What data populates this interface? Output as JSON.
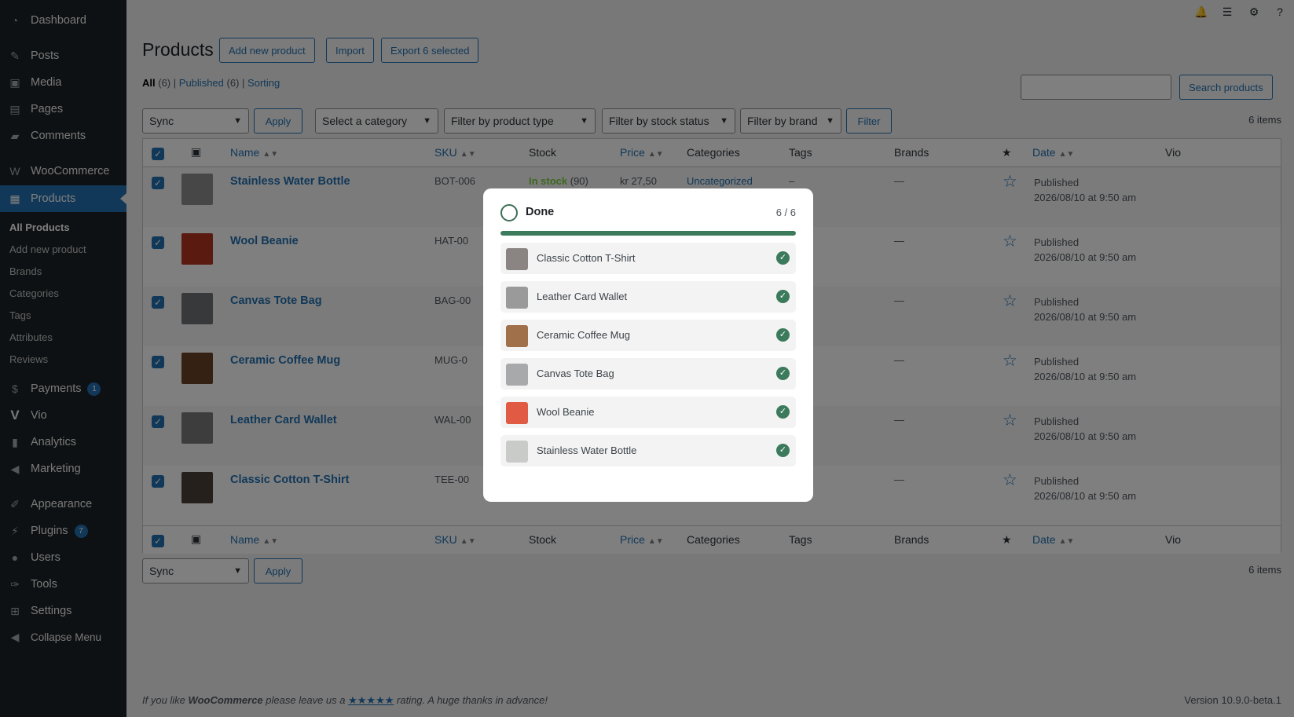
{
  "sidebar": {
    "top": [
      {
        "label": "Dashboard",
        "icon": "dashboard-icon"
      },
      {
        "label": "Posts",
        "icon": "pin-icon"
      },
      {
        "label": "Media",
        "icon": "media-icon"
      },
      {
        "label": "Pages",
        "icon": "page-icon"
      },
      {
        "label": "Comments",
        "icon": "comment-icon"
      },
      {
        "label": "WooCommerce",
        "icon": "woocommerce-icon"
      },
      {
        "label": "Products",
        "icon": "products-icon"
      }
    ],
    "submenu": [
      "All Products",
      "Add new product",
      "Brands",
      "Categories",
      "Tags",
      "Attributes",
      "Reviews"
    ],
    "bottom": [
      {
        "label": "Payments",
        "icon": "payments-icon",
        "badge": "1"
      },
      {
        "label": "Vio",
        "icon": "vio-icon"
      },
      {
        "label": "Analytics",
        "icon": "analytics-icon"
      },
      {
        "label": "Marketing",
        "icon": "megaphone-icon"
      },
      {
        "label": "Appearance",
        "icon": "brush-icon"
      },
      {
        "label": "Plugins",
        "icon": "plugin-icon",
        "badge": "7"
      },
      {
        "label": "Users",
        "icon": "users-icon"
      },
      {
        "label": "Tools",
        "icon": "wrench-icon"
      },
      {
        "label": "Settings",
        "icon": "settings-icon"
      },
      {
        "label": "Collapse Menu",
        "icon": "collapse-icon"
      }
    ]
  },
  "header": {
    "title": "Products",
    "add_new": "Add new product",
    "import": "Import",
    "export": "Export 6 selected"
  },
  "views": {
    "all": "All",
    "all_count": "(6)",
    "published": "Published",
    "published_count": "(6)",
    "sorting": "Sorting",
    "sep": "|"
  },
  "search": {
    "button": "Search products",
    "value": ""
  },
  "filters": {
    "bulk_action": "Sync",
    "apply": "Apply",
    "category": "Select a category",
    "product_type": "Filter by product type",
    "stock_status": "Filter by stock status",
    "brand": "Filter by brand",
    "filter": "Filter",
    "items_count": "6 items"
  },
  "columns": {
    "name": "Name",
    "sku": "SKU",
    "stock": "Stock",
    "price": "Price",
    "categories": "Categories",
    "tags": "Tags",
    "brands": "Brands",
    "date": "Date",
    "vio": "Vio"
  },
  "products": [
    {
      "name": "Stainless Water Bottle",
      "sku": "BOT-006",
      "stock_status": "In stock",
      "stock_qty": "(90)",
      "price": "kr 27,50",
      "category": "Uncategorized",
      "tags": "–",
      "brands": "—",
      "status": "Published",
      "date": "2026/08/10 at 9:50 am",
      "thumb_color": "#8d8f8c"
    },
    {
      "name": "Wool Beanie",
      "sku": "HAT-00",
      "stock_status": "",
      "stock_qty": "",
      "price": "",
      "category": "",
      "tags": "–",
      "brands": "—",
      "status": "Published",
      "date": "2026/08/10 at 9:50 am",
      "thumb_color": "#b5351f"
    },
    {
      "name": "Canvas Tote Bag",
      "sku": "BAG-00",
      "stock_status": "",
      "stock_qty": "",
      "price": "",
      "category": "",
      "tags": "–",
      "brands": "—",
      "status": "Published",
      "date": "2026/08/10 at 9:50 am",
      "thumb_color": "#6e7274"
    },
    {
      "name": "Ceramic Coffee Mug",
      "sku": "MUG-0",
      "stock_status": "",
      "stock_qty": "",
      "price": "",
      "category": "",
      "tags": "–",
      "brands": "—",
      "status": "Published",
      "date": "2026/08/10 at 9:50 am",
      "thumb_color": "#6b4226"
    },
    {
      "name": "Leather Card Wallet",
      "sku": "WAL-00",
      "stock_status": "",
      "stock_qty": "",
      "price": "",
      "category": "",
      "tags": "–",
      "brands": "—",
      "status": "Published",
      "date": "2026/08/10 at 9:50 am",
      "thumb_color": "#7a7a7a"
    },
    {
      "name": "Classic Cotton T-Shirt",
      "sku": "TEE-00",
      "stock_status": "",
      "stock_qty": "",
      "price": "",
      "category": "",
      "tags": "–",
      "brands": "—",
      "status": "Published",
      "date": "2026/08/10 at 9:50 am",
      "thumb_color": "#4c4038"
    }
  ],
  "footer": {
    "thanks_prefix": "If you like",
    "brand": "WooCommerce",
    "thanks_mid": "please leave us a",
    "stars": "★★★★★",
    "thanks_suffix": "rating. A huge thanks in advance!",
    "version": "Version 10.9.0-beta.1"
  },
  "modal": {
    "title": "Done",
    "count": "6 / 6",
    "progress": 1.0,
    "items": [
      {
        "name": "Classic Cotton T-Shirt",
        "thumb_color": "#8a8582"
      },
      {
        "name": "Leather Card Wallet",
        "thumb_color": "#9a9a9a"
      },
      {
        "name": "Ceramic Coffee Mug",
        "thumb_color": "#a0704a"
      },
      {
        "name": "Canvas Tote Bag",
        "thumb_color": "#a7a9ab"
      },
      {
        "name": "Wool Beanie",
        "thumb_color": "#e05a44"
      },
      {
        "name": "Stainless Water Bottle",
        "thumb_color": "#c9cbc9"
      }
    ]
  }
}
